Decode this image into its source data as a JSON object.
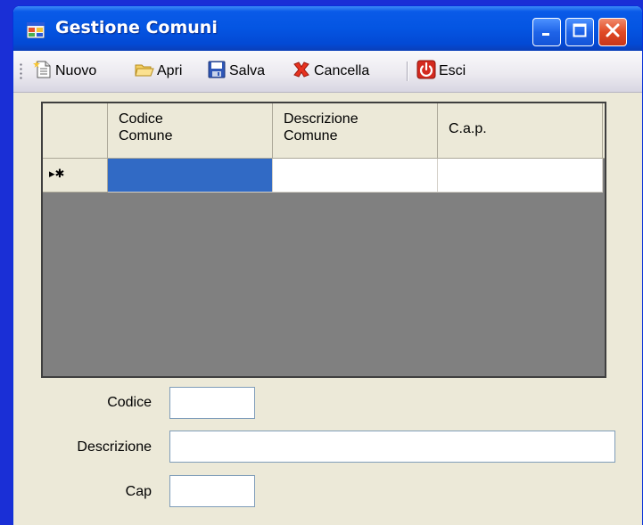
{
  "window": {
    "title": "Gestione Comuni"
  },
  "toolbar": {
    "items": [
      {
        "label": "Nuovo",
        "icon": "new-document-icon"
      },
      {
        "label": "Apri",
        "icon": "open-folder-icon"
      },
      {
        "label": "Salva",
        "icon": "save-disk-icon"
      },
      {
        "label": "Cancella",
        "icon": "delete-x-icon"
      },
      {
        "label": "Esci",
        "icon": "exit-power-icon"
      }
    ]
  },
  "grid": {
    "columns": [
      {
        "line1": "Codice",
        "line2": "Comune"
      },
      {
        "line1": "Descrizione",
        "line2": "Comune"
      },
      {
        "line1": "C.a.p.",
        "line2": ""
      }
    ],
    "new_row_marker": "▸✱"
  },
  "form": {
    "codice_label": "Codice",
    "codice_value": "",
    "descrizione_label": "Descrizione",
    "descrizione_value": "",
    "cap_label": "Cap",
    "cap_value": ""
  },
  "colors": {
    "desktop": "#1a2fd6",
    "titlebar": "#0455e2",
    "selection": "#316ac5",
    "grid_background": "#808080"
  }
}
